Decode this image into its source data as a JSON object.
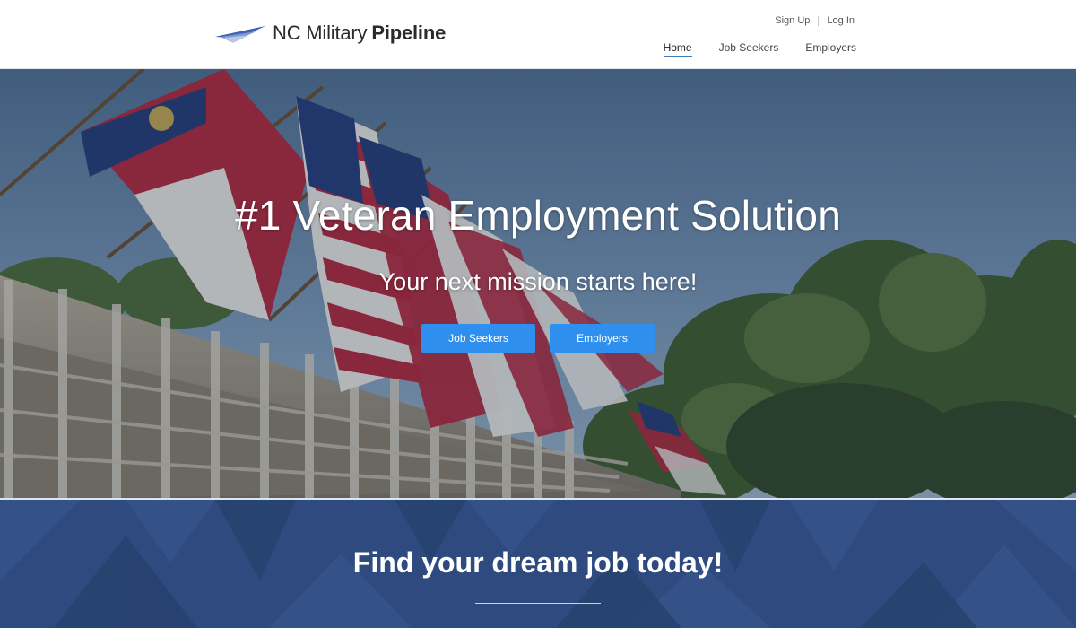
{
  "header": {
    "logo": {
      "text_light": "NC Military",
      "text_bold": "Pipeline",
      "icon": "arrow-logo-icon"
    },
    "utility_nav": {
      "sign_up": "Sign Up",
      "log_in": "Log In"
    },
    "main_nav": {
      "items": [
        {
          "label": "Home",
          "active": true
        },
        {
          "label": "Job Seekers",
          "active": false
        },
        {
          "label": "Employers",
          "active": false
        }
      ]
    }
  },
  "hero": {
    "title": "#1 Veteran Employment Solution",
    "subtitle": "Your next mission starts here!",
    "buttons": {
      "job_seekers": "Job Seekers",
      "employers": "Employers"
    }
  },
  "section": {
    "title": "Find your dream job today!"
  },
  "colors": {
    "accent_button": "#2f8fef",
    "nav_active_underline": "#3a7bbf",
    "section_background": "#2e4a7e",
    "logo_blue": "#1f3f8a"
  }
}
